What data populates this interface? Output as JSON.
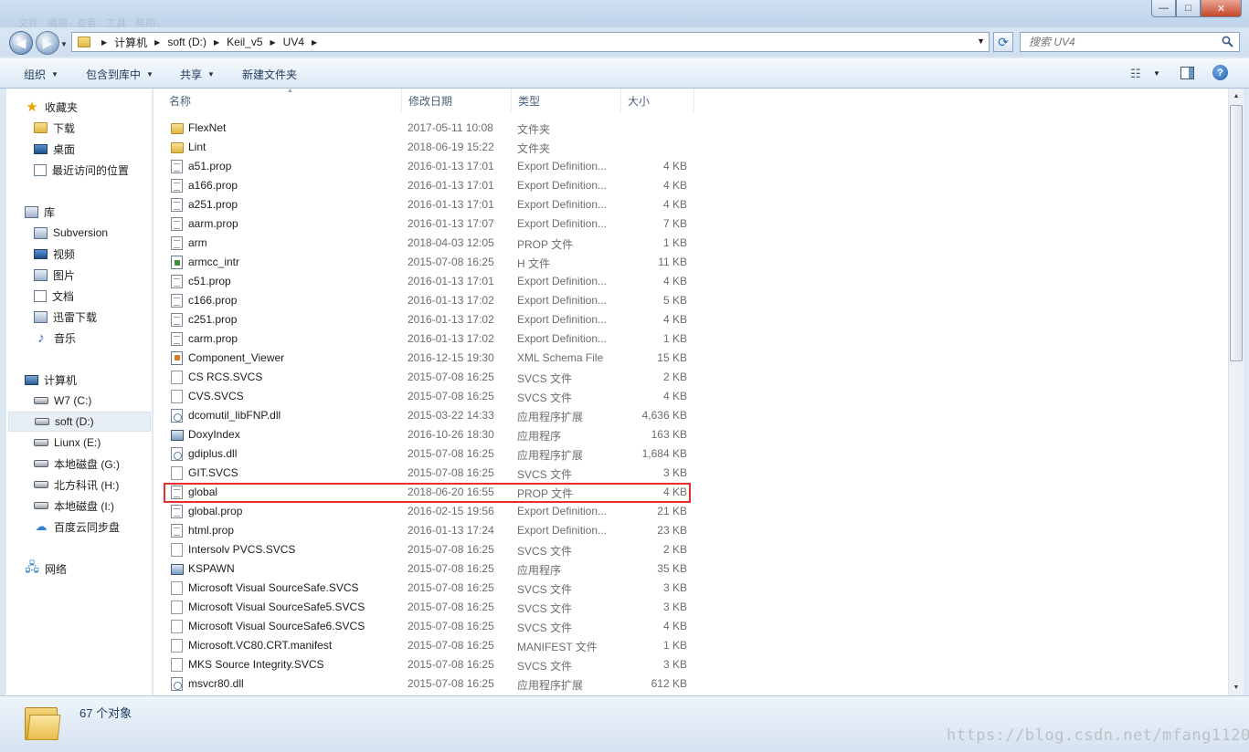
{
  "window": {
    "menu_ghost": [
      "文件",
      "编辑",
      "查看",
      "工具",
      "帮助"
    ],
    "min_label": "—",
    "max_label": "□",
    "close_label": "✕"
  },
  "address": {
    "crumbs": [
      "计算机",
      "soft (D:)",
      "Keil_v5",
      "UV4"
    ],
    "search_placeholder": "搜索 UV4"
  },
  "toolbar": {
    "organize": "组织",
    "include_library": "包含到库中",
    "share": "共享",
    "new_folder": "新建文件夹"
  },
  "sidebar": {
    "favorites": "收藏夹",
    "downloads": "下载",
    "desktop": "桌面",
    "recent": "最近访问的位置",
    "libraries": "库",
    "subversion": "Subversion",
    "videos": "视频",
    "pictures": "图片",
    "documents": "文档",
    "xunlei": "迅雷下载",
    "music": "音乐",
    "computer": "计算机",
    "drive_c": "W7 (C:)",
    "drive_d": "soft (D:)",
    "drive_e": "Liunx (E:)",
    "drive_g": "本地磁盘 (G:)",
    "drive_h": "北方科讯 (H:)",
    "drive_i": "本地磁盘 (I:)",
    "baidu": "百度云同步盘",
    "network": "网络"
  },
  "columns": {
    "name": "名称",
    "date": "修改日期",
    "type": "类型",
    "size": "大小"
  },
  "files": [
    {
      "name": "FlexNet",
      "date": "2017-05-11 10:08",
      "type": "文件夹",
      "size": "",
      "icon": "folder"
    },
    {
      "name": "Lint",
      "date": "2018-06-19 15:22",
      "type": "文件夹",
      "size": "",
      "icon": "folder"
    },
    {
      "name": "a51.prop",
      "date": "2016-01-13 17:01",
      "type": "Export Definition...",
      "size": "4 KB",
      "icon": "doc"
    },
    {
      "name": "a166.prop",
      "date": "2016-01-13 17:01",
      "type": "Export Definition...",
      "size": "4 KB",
      "icon": "doc"
    },
    {
      "name": "a251.prop",
      "date": "2016-01-13 17:01",
      "type": "Export Definition...",
      "size": "4 KB",
      "icon": "doc"
    },
    {
      "name": "aarm.prop",
      "date": "2016-01-13 17:07",
      "type": "Export Definition...",
      "size": "7 KB",
      "icon": "doc"
    },
    {
      "name": "arm",
      "date": "2018-04-03 12:05",
      "type": "PROP 文件",
      "size": "1 KB",
      "icon": "doc"
    },
    {
      "name": "armcc_intr",
      "date": "2015-07-08 16:25",
      "type": "H 文件",
      "size": "11 KB",
      "icon": "h"
    },
    {
      "name": "c51.prop",
      "date": "2016-01-13 17:01",
      "type": "Export Definition...",
      "size": "4 KB",
      "icon": "doc"
    },
    {
      "name": "c166.prop",
      "date": "2016-01-13 17:02",
      "type": "Export Definition...",
      "size": "5 KB",
      "icon": "doc"
    },
    {
      "name": "c251.prop",
      "date": "2016-01-13 17:02",
      "type": "Export Definition...",
      "size": "4 KB",
      "icon": "doc"
    },
    {
      "name": "carm.prop",
      "date": "2016-01-13 17:02",
      "type": "Export Definition...",
      "size": "1 KB",
      "icon": "doc"
    },
    {
      "name": "Component_Viewer",
      "date": "2016-12-15 19:30",
      "type": "XML Schema File",
      "size": "15 KB",
      "icon": "xml"
    },
    {
      "name": "CS RCS.SVCS",
      "date": "2015-07-08 16:25",
      "type": "SVCS 文件",
      "size": "2 KB",
      "icon": "blank"
    },
    {
      "name": "CVS.SVCS",
      "date": "2015-07-08 16:25",
      "type": "SVCS 文件",
      "size": "4 KB",
      "icon": "blank"
    },
    {
      "name": "dcomutil_libFNP.dll",
      "date": "2015-03-22 14:33",
      "type": "应用程序扩展",
      "size": "4,636 KB",
      "icon": "dll"
    },
    {
      "name": "DoxyIndex",
      "date": "2016-10-26 18:30",
      "type": "应用程序",
      "size": "163 KB",
      "icon": "exe"
    },
    {
      "name": "gdiplus.dll",
      "date": "2015-07-08 16:25",
      "type": "应用程序扩展",
      "size": "1,684 KB",
      "icon": "dll"
    },
    {
      "name": "GIT.SVCS",
      "date": "2015-07-08 16:25",
      "type": "SVCS 文件",
      "size": "3 KB",
      "icon": "blank"
    },
    {
      "name": "global",
      "date": "2018-06-20 16:55",
      "type": "PROP 文件",
      "size": "4 KB",
      "icon": "doc"
    },
    {
      "name": "global.prop",
      "date": "2016-02-15 19:56",
      "type": "Export Definition...",
      "size": "21 KB",
      "icon": "doc"
    },
    {
      "name": "html.prop",
      "date": "2016-01-13 17:24",
      "type": "Export Definition...",
      "size": "23 KB",
      "icon": "doc"
    },
    {
      "name": "Intersolv PVCS.SVCS",
      "date": "2015-07-08 16:25",
      "type": "SVCS 文件",
      "size": "2 KB",
      "icon": "blank"
    },
    {
      "name": "KSPAWN",
      "date": "2015-07-08 16:25",
      "type": "应用程序",
      "size": "35 KB",
      "icon": "exe"
    },
    {
      "name": "Microsoft Visual SourceSafe.SVCS",
      "date": "2015-07-08 16:25",
      "type": "SVCS 文件",
      "size": "3 KB",
      "icon": "blank"
    },
    {
      "name": "Microsoft Visual SourceSafe5.SVCS",
      "date": "2015-07-08 16:25",
      "type": "SVCS 文件",
      "size": "3 KB",
      "icon": "blank"
    },
    {
      "name": "Microsoft Visual SourceSafe6.SVCS",
      "date": "2015-07-08 16:25",
      "type": "SVCS 文件",
      "size": "4 KB",
      "icon": "blank"
    },
    {
      "name": "Microsoft.VC80.CRT.manifest",
      "date": "2015-07-08 16:25",
      "type": "MANIFEST 文件",
      "size": "1 KB",
      "icon": "blank"
    },
    {
      "name": "MKS Source Integrity.SVCS",
      "date": "2015-07-08 16:25",
      "type": "SVCS 文件",
      "size": "3 KB",
      "icon": "blank"
    },
    {
      "name": "msvcr80.dll",
      "date": "2015-07-08 16:25",
      "type": "应用程序扩展",
      "size": "612 KB",
      "icon": "dll"
    }
  ],
  "status": {
    "count": "67 个对象"
  },
  "watermark": "https://blog.csdn.net/mfang1120",
  "colors": {
    "highlight": "#e5302b",
    "accent": "#1e395b"
  }
}
